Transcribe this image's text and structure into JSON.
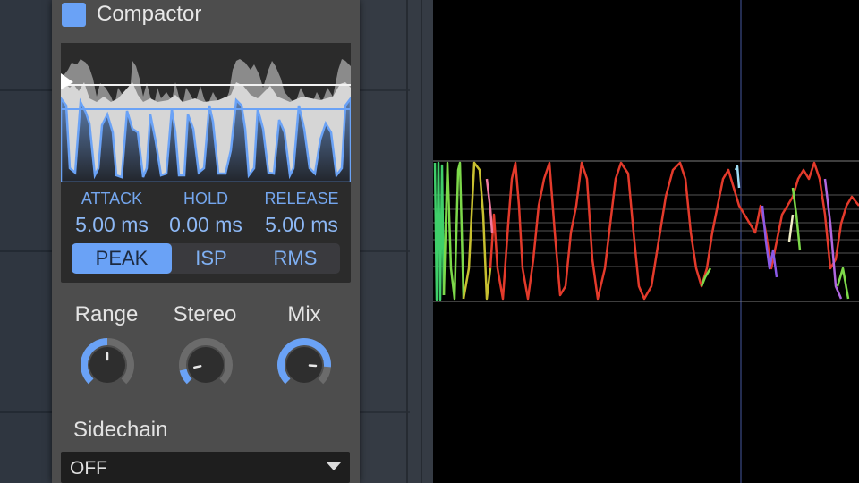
{
  "plugin": {
    "title": "Compactor",
    "enabled": true,
    "accent_color": "#6aa2f6",
    "params": [
      {
        "label": "ATTACK",
        "value": "5.00 ms"
      },
      {
        "label": "HOLD",
        "value": "0.00 ms"
      },
      {
        "label": "RELEASE",
        "value": "5.00 ms"
      }
    ],
    "detection_modes": [
      "PEAK",
      "ISP",
      "RMS"
    ],
    "active_mode": "PEAK",
    "knobs": [
      {
        "label": "Range",
        "value": 0.5
      },
      {
        "label": "Stereo",
        "value": 0.12
      },
      {
        "label": "Mix",
        "value": 0.85
      }
    ],
    "sidechain": {
      "label": "Sidechain",
      "value": "OFF"
    }
  }
}
